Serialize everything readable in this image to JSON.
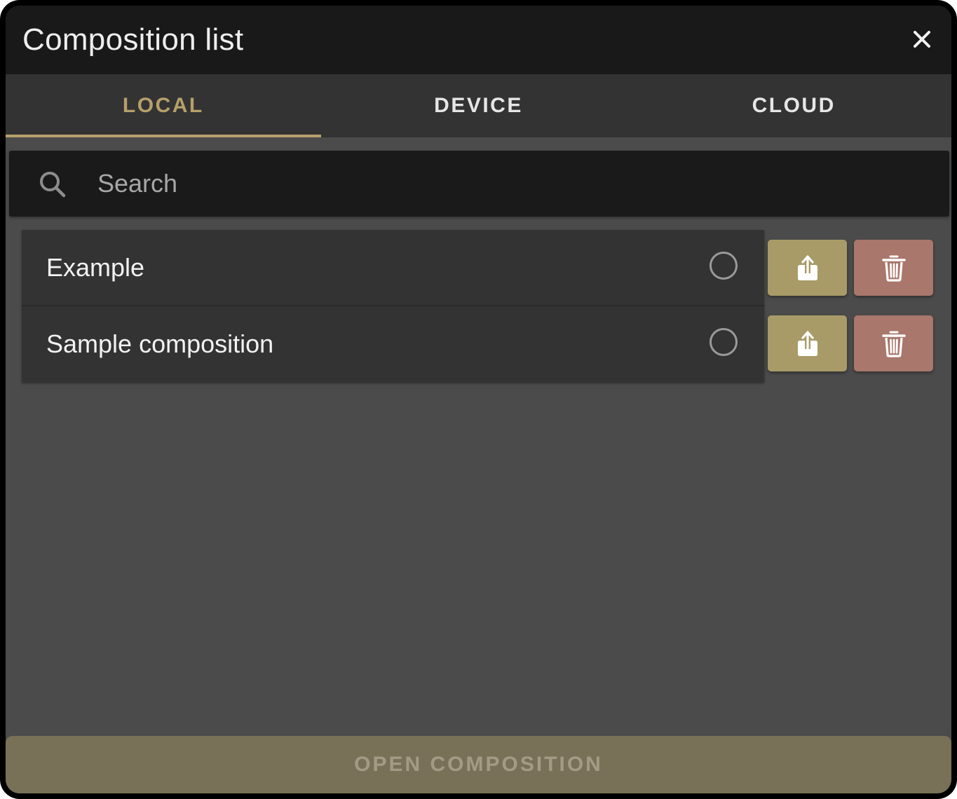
{
  "dialog": {
    "title": "Composition list",
    "close_icon": "close-icon"
  },
  "tabs": [
    {
      "label": "LOCAL",
      "active": true
    },
    {
      "label": "DEVICE",
      "active": false
    },
    {
      "label": "CLOUD",
      "active": false
    }
  ],
  "search": {
    "placeholder": "Search",
    "value": "",
    "icon": "search-icon"
  },
  "compositions": [
    {
      "name": "Example",
      "selected": false
    },
    {
      "name": "Sample composition",
      "selected": false
    }
  ],
  "row_actions": {
    "export_icon": "share-upload-icon",
    "delete_icon": "trash-icon"
  },
  "footer": {
    "open_label": "OPEN COMPOSITION",
    "enabled": false
  },
  "colors": {
    "accent": "#b6a06a",
    "export_button": "#a89b67",
    "delete_button": "#a9776b",
    "open_button_disabled": "#787157"
  }
}
